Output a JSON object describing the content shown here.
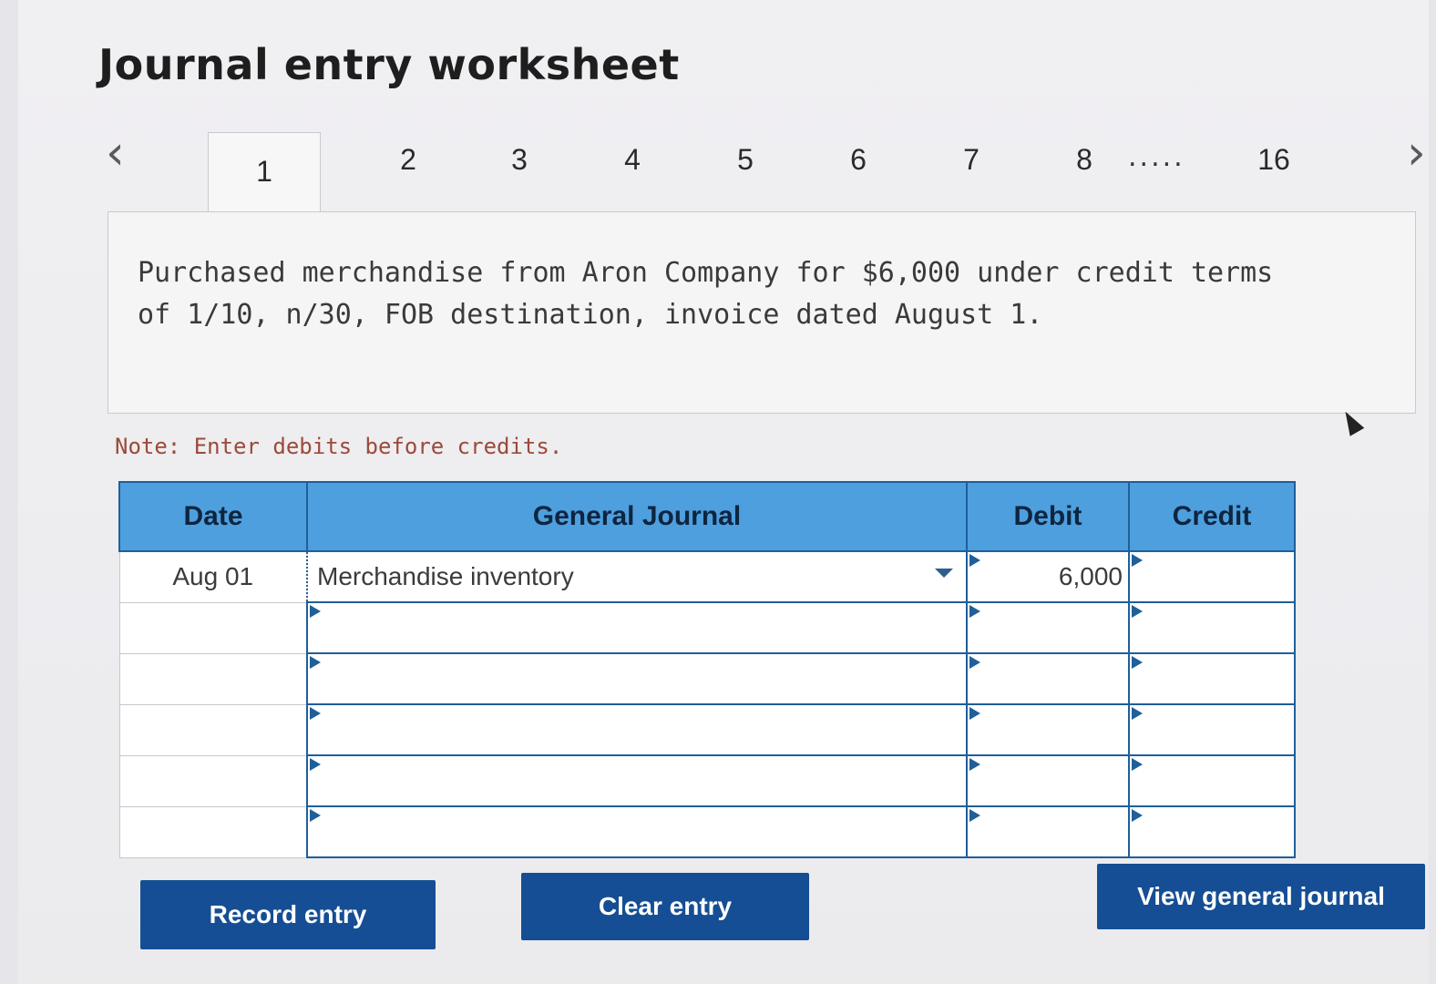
{
  "title": "Journal entry worksheet",
  "nav": {
    "prev_icon": "‹",
    "next_icon": "›",
    "tabs": [
      "1",
      "2",
      "3",
      "4",
      "5",
      "6",
      "7",
      "8",
      "16"
    ],
    "ellipsis": ".....",
    "active_tab": "1"
  },
  "prompt": "Purchased merchandise from Aron Company for $6,000 under credit terms of 1/10, n/30, FOB destination, invoice dated August 1.",
  "note": "Note: Enter debits before credits.",
  "table": {
    "headers": {
      "date": "Date",
      "journal": "General Journal",
      "debit": "Debit",
      "credit": "Credit"
    },
    "rows": [
      {
        "date": "Aug 01",
        "account": "Merchandise inventory",
        "debit": "6,000",
        "credit": ""
      },
      {
        "date": "",
        "account": "",
        "debit": "",
        "credit": ""
      },
      {
        "date": "",
        "account": "",
        "debit": "",
        "credit": ""
      },
      {
        "date": "",
        "account": "",
        "debit": "",
        "credit": ""
      },
      {
        "date": "",
        "account": "",
        "debit": "",
        "credit": ""
      },
      {
        "date": "",
        "account": "",
        "debit": "",
        "credit": ""
      }
    ]
  },
  "buttons": {
    "record": "Record entry",
    "clear": "Clear entry",
    "view": "View general journal"
  },
  "colors": {
    "header_bg": "#4e9fde",
    "button_bg": "#154e94",
    "note_text": "#9b4a3a"
  }
}
